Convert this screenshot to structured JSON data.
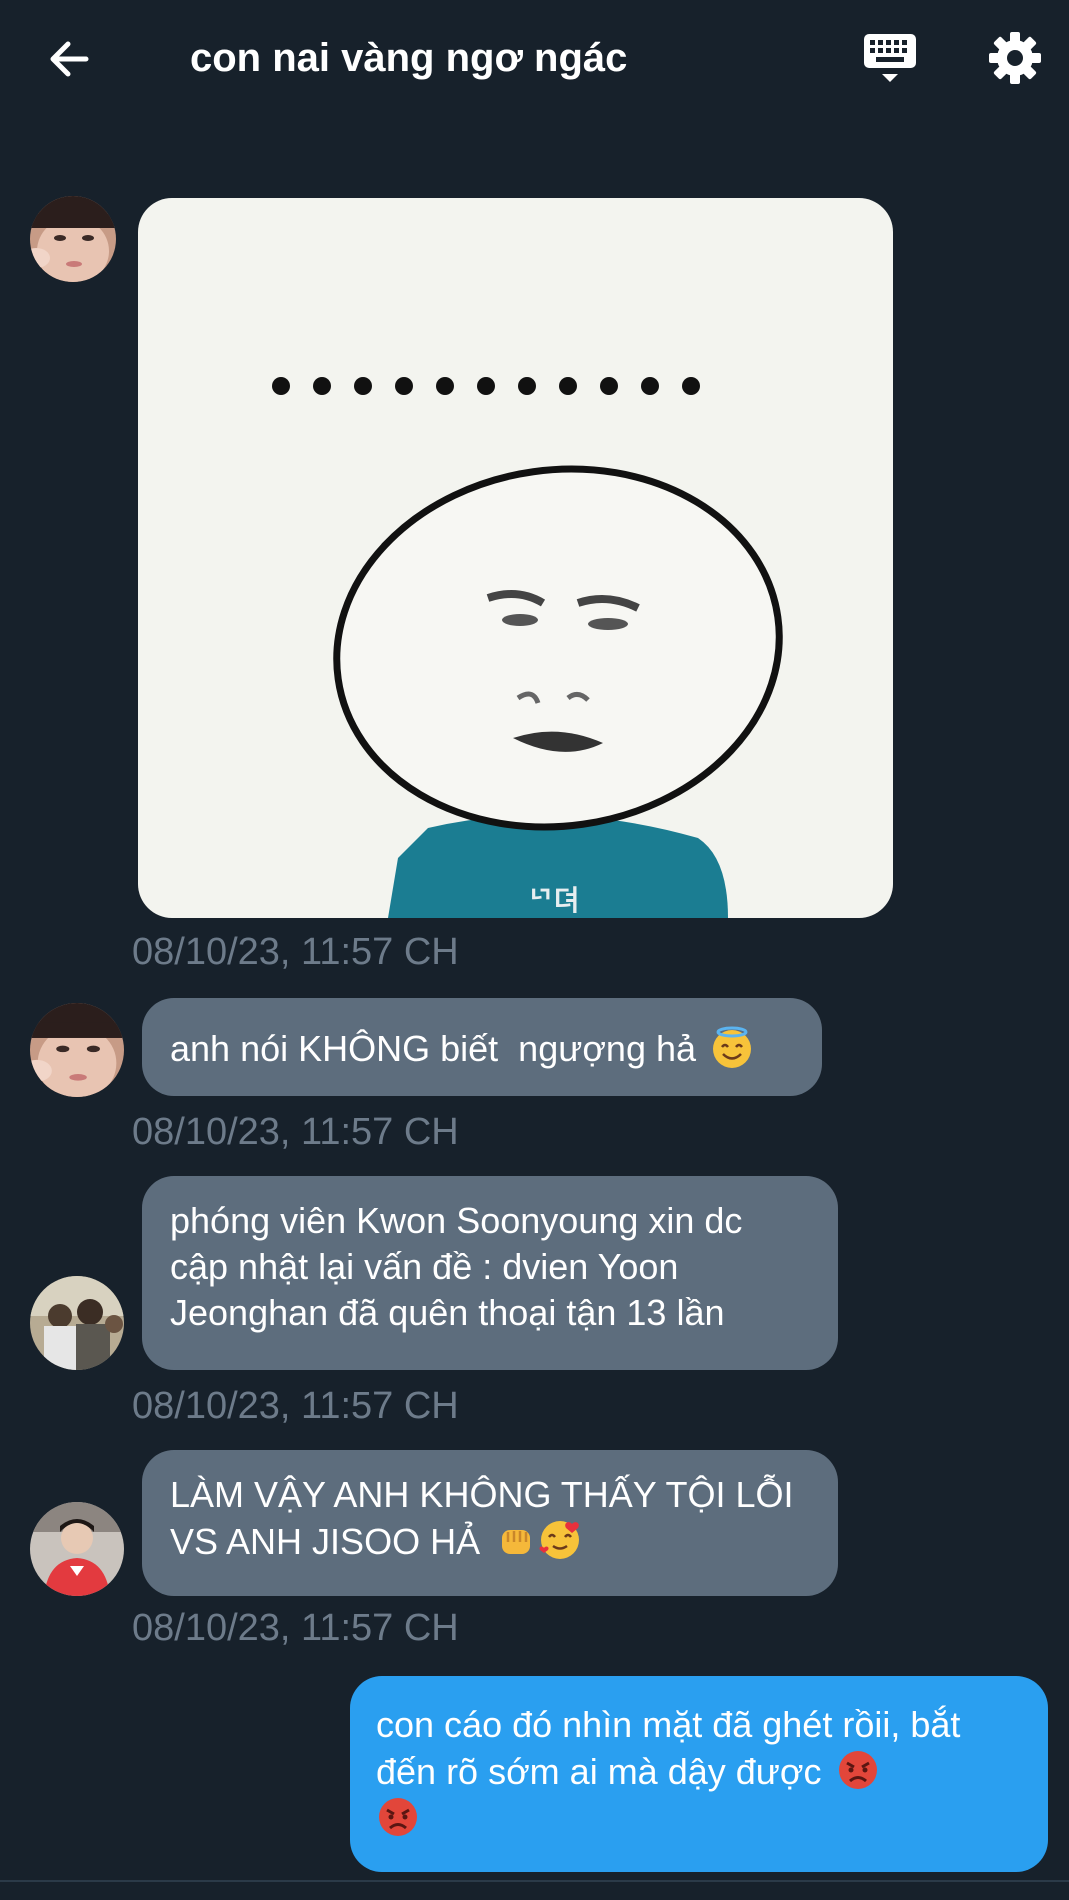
{
  "header": {
    "title": "con nai vàng ngơ ngác",
    "back_icon": "arrow-left-icon",
    "keyboard_icon": "keyboard-icon",
    "settings_icon": "gear-icon"
  },
  "messages": [
    {
      "type": "sticker",
      "sender_avatar": "avatar-girl",
      "timestamp": "08/10/23, 11:57 CH"
    },
    {
      "type": "text",
      "sender_avatar": "avatar-girl",
      "text": "anh nói KHÔNG biết  ngượng hả",
      "emoji": [
        "halo-smile-emoji"
      ],
      "timestamp": "08/10/23, 11:57 CH"
    },
    {
      "type": "text",
      "sender_avatar": "avatar-boy-group",
      "text": "phóng viên Kwon Soonyoung xin dc cập nhật lại vấn đề : dvien Yoon Jeonghan đã quên thoại tận 13 lần",
      "timestamp": "08/10/23, 11:57 CH"
    },
    {
      "type": "text",
      "sender_avatar": "avatar-boy-red",
      "text": "LÀM VẬY ANH KHÔNG THẤY TỘI LỖI VS ANH JISOO HẢ",
      "emoji": [
        "fist-emoji",
        "heart-face-emoji"
      ],
      "timestamp": "08/10/23, 11:57 CH"
    },
    {
      "type": "text",
      "outgoing": true,
      "text": "con cáo đó nhìn mặt đã ghét rồii, bắt đến rõ sớm ai mà dậy được",
      "emoji": [
        "angry-face-emoji",
        "angry-face-emoji"
      ]
    }
  ],
  "colors": {
    "background": "#17212b",
    "incoming_bubble": "#5d6d7d",
    "outgoing_bubble": "#2a9ff0",
    "timestamp": "#6d7b8a"
  }
}
